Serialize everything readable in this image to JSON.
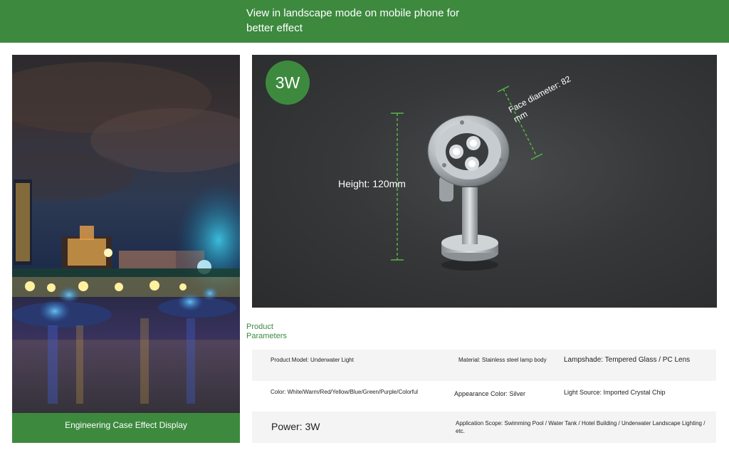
{
  "banner": {
    "text": "View in landscape mode on mobile phone for better effect",
    "color": "#3d8a3f"
  },
  "case_display": {
    "caption": "Engineering Case Effect Display"
  },
  "product": {
    "power_badge": "3W",
    "height_label": "Height: 120mm",
    "face_label": "Face diameter: 82 mm"
  },
  "parameters": {
    "title": "Product Parameters",
    "rows": [
      {
        "c1": "Product Model: Underwater Light",
        "c2": "Material: Stainless steel lamp body",
        "c3": "Lampshade: Tempered Glass / PC Lens"
      },
      {
        "c1": "Color: White/Warm/Red/Yellow/Blue/Green/Purple/Colorful",
        "c2": "Appearance Color: Silver",
        "c3": "Light Source: Imported Crystal Chip"
      },
      {
        "c1": "Power: 3W",
        "c2": "Application Scope: Swimming Pool / Water Tank / Hotel Building / Underwater Landscape Lighting / etc."
      }
    ]
  }
}
